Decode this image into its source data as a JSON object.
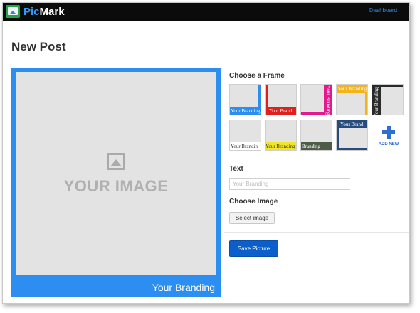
{
  "app": {
    "name_prefix": "Pic",
    "name_suffix": "Mark"
  },
  "nav": {
    "dashboard": "Dashboard"
  },
  "page": {
    "title": "New Post"
  },
  "preview": {
    "placeholder": "YOUR IMAGE",
    "branding": "Your Branding"
  },
  "frames_section": {
    "title": "Choose a Frame",
    "frames": [
      {
        "label": "Your Branding",
        "color": "#2b8ef0"
      },
      {
        "label": "Your Brand",
        "color": "#e0201c"
      },
      {
        "label": "Your Branding",
        "color": "#e5198e"
      },
      {
        "label": "Your Branding",
        "color": "#f4b21b"
      },
      {
        "label": "Your Branding",
        "color": "#2a2a2a"
      },
      {
        "label": "Your Brandin",
        "color": "#ffffff"
      },
      {
        "label": "Your Branding",
        "color": "#f2e622"
      },
      {
        "label": "Branding",
        "color": "#4d5c47"
      },
      {
        "label": "Your Brand",
        "color": "#264b7c"
      }
    ],
    "add_new": "ADD NEW"
  },
  "text_section": {
    "title": "Text",
    "placeholder": "Your Branding",
    "value": ""
  },
  "image_section": {
    "title": "Choose Image",
    "button": "Select image"
  },
  "save_button": "Save Picture"
}
